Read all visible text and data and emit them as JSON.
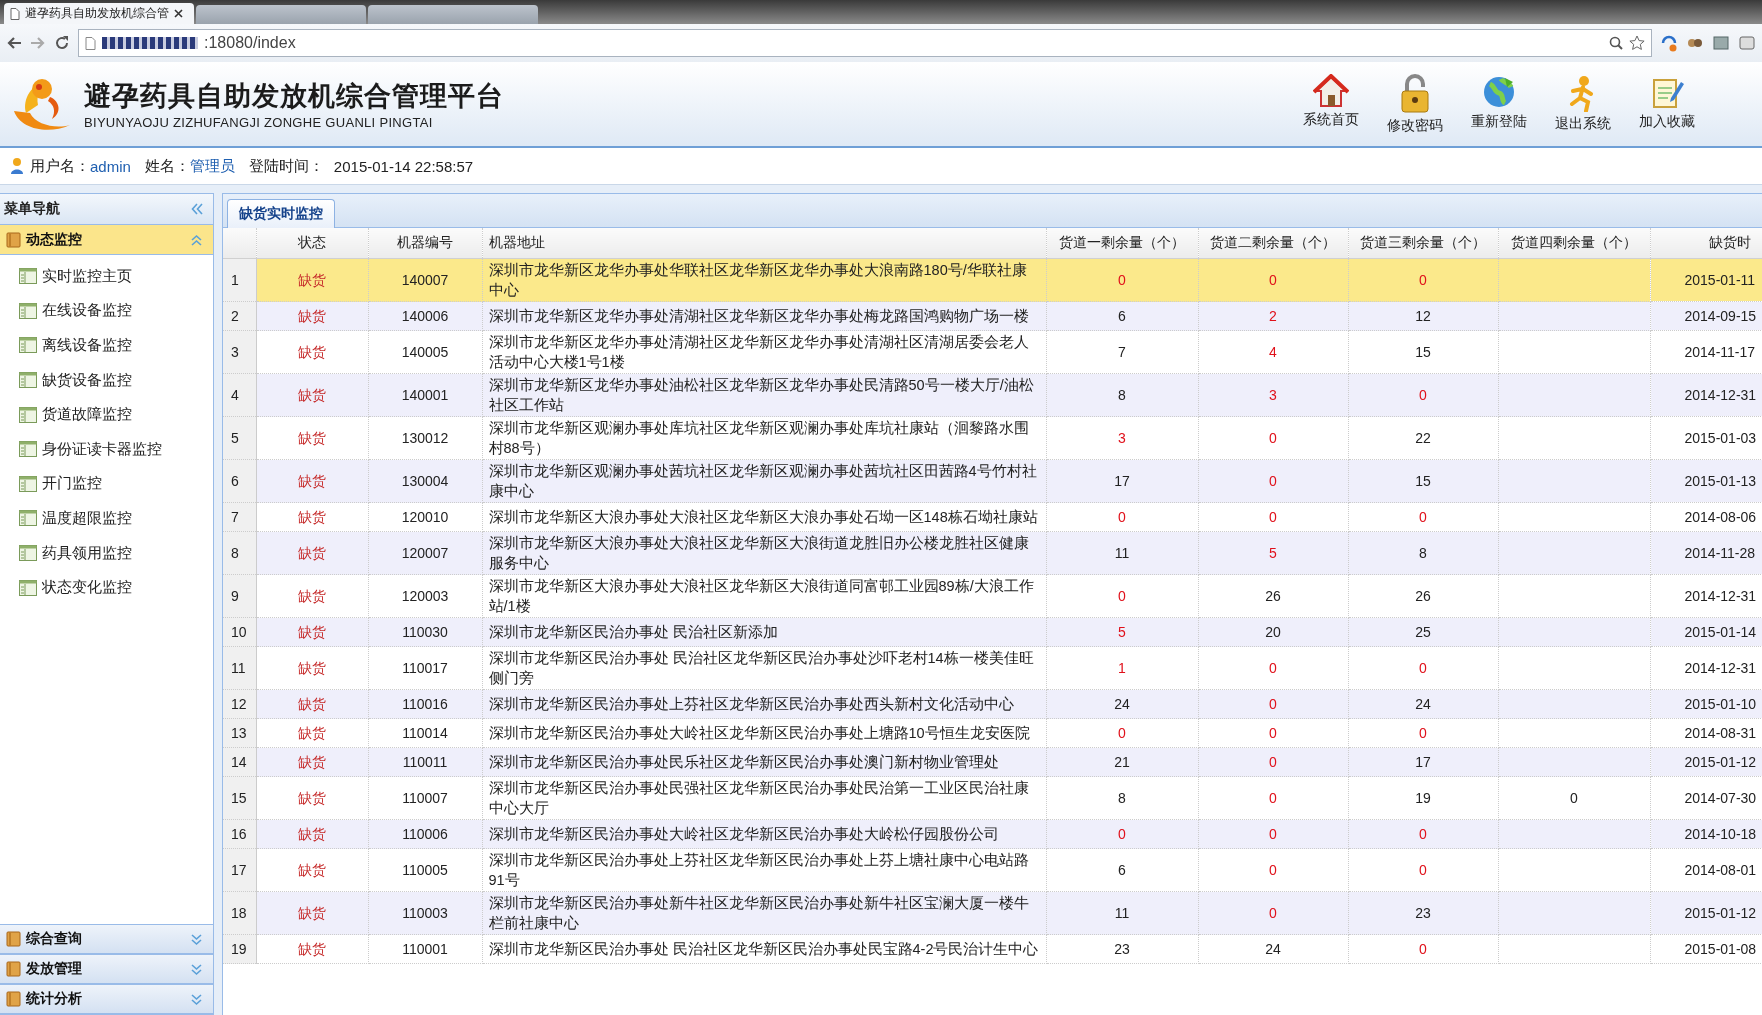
{
  "browser": {
    "tabs": [
      {
        "title": "避孕药具自助发放机综合管",
        "selected": true
      },
      {
        "selected": false
      },
      {
        "selected": false
      }
    ],
    "address": ":18080/index"
  },
  "header": {
    "title": "避孕药具自助发放机综合管理平台",
    "subtitle": "BIYUNYAOJU ZIZHUFANGJI ZONGHE GUANLI PINGTAI",
    "actions": [
      {
        "label": "系统首页",
        "kind": "home"
      },
      {
        "label": "修改密码",
        "kind": "lock"
      },
      {
        "label": "重新登陆",
        "kind": "globe"
      },
      {
        "label": "退出系统",
        "kind": "exit"
      },
      {
        "label": "加入收藏",
        "kind": "favorite"
      }
    ]
  },
  "user_bar": {
    "username_label": "用户名：",
    "username": "admin",
    "name_label": "姓名：",
    "name": "管理员",
    "login_label": "登陆时间：",
    "login_time": "2015-01-14 22:58:57"
  },
  "sidebar": {
    "title": "菜单导航",
    "groups": [
      {
        "label": "动态监控",
        "expanded": true,
        "items": [
          "实时监控主页",
          "在线设备监控",
          "离线设备监控",
          "缺货设备监控",
          "货道故障监控",
          "身份证读卡器监控",
          "开门监控",
          "温度超限监控",
          "药具领用监控",
          "状态变化监控"
        ]
      },
      {
        "label": "综合查询",
        "expanded": false
      },
      {
        "label": "发放管理",
        "expanded": false
      },
      {
        "label": "统计分析",
        "expanded": false
      }
    ]
  },
  "tabs": [
    {
      "label": "缺货实时监控",
      "selected": true
    }
  ],
  "table": {
    "columns": [
      "状态",
      "机器编号",
      "机器地址",
      "货道一剩余量（个）",
      "货道二剩余量（个）",
      "货道三剩余量（个）",
      "货道四剩余量（个）",
      "缺货时"
    ],
    "rows": [
      {
        "index": "1",
        "selected": true,
        "status": "缺货",
        "machine": "140007",
        "address": "深圳市龙华新区龙华办事处华联社区龙华新区龙华办事处大浪南路180号/华联社康中心",
        "lanes": [
          {
            "value": "0",
            "alert": true
          },
          {
            "value": "0",
            "alert": true
          },
          {
            "value": "0",
            "alert": true
          }
        ],
        "time": "2015-01-11"
      },
      {
        "index": "2",
        "selected": false,
        "status": "缺货",
        "machine": "140006",
        "address": "深圳市龙华新区龙华办事处清湖社区龙华新区龙华办事处梅龙路国鸿购物广场一楼",
        "lanes": [
          {
            "value": "6",
            "alert": false
          },
          {
            "value": "2",
            "alert": true
          },
          {
            "value": "12",
            "alert": false
          }
        ],
        "time": "2014-09-15"
      },
      {
        "index": "3",
        "selected": false,
        "status": "缺货",
        "machine": "140005",
        "address": "深圳市龙华新区龙华办事处清湖社区龙华新区龙华办事处清湖社区清湖居委会老人活动中心大楼1号1楼",
        "lanes": [
          {
            "value": "7",
            "alert": false
          },
          {
            "value": "4",
            "alert": true
          },
          {
            "value": "15",
            "alert": false
          }
        ],
        "time": "2014-11-17"
      },
      {
        "index": "4",
        "selected": false,
        "status": "缺货",
        "machine": "140001",
        "address": "深圳市龙华新区龙华办事处油松社区龙华新区龙华办事处民清路50号一楼大厅/油松社区工作站",
        "lanes": [
          {
            "value": "8",
            "alert": false
          },
          {
            "value": "3",
            "alert": true
          },
          {
            "value": "0",
            "alert": true
          }
        ],
        "time": "2014-12-31"
      },
      {
        "index": "5",
        "selected": false,
        "status": "缺货",
        "machine": "130012",
        "address": "深圳市龙华新区观澜办事处库坑社区龙华新区观澜办事处库坑社康站（洄黎路水围村88号）",
        "lanes": [
          {
            "value": "3",
            "alert": true
          },
          {
            "value": "0",
            "alert": true
          },
          {
            "value": "22",
            "alert": false
          }
        ],
        "time": "2015-01-03"
      },
      {
        "index": "6",
        "selected": false,
        "status": "缺货",
        "machine": "130004",
        "address": "深圳市龙华新区观澜办事处茜坑社区龙华新区观澜办事处茜坑社区田茜路4号竹村社康中心",
        "lanes": [
          {
            "value": "17",
            "alert": false
          },
          {
            "value": "0",
            "alert": true
          },
          {
            "value": "15",
            "alert": false
          }
        ],
        "time": "2015-01-13"
      },
      {
        "index": "7",
        "selected": false,
        "status": "缺货",
        "machine": "120010",
        "address": "深圳市龙华新区大浪办事处大浪社区龙华新区大浪办事处石坳一区148栋石坳社康站",
        "lanes": [
          {
            "value": "0",
            "alert": true
          },
          {
            "value": "0",
            "alert": true
          },
          {
            "value": "0",
            "alert": true
          }
        ],
        "time": "2014-08-06"
      },
      {
        "index": "8",
        "selected": false,
        "status": "缺货",
        "machine": "120007",
        "address": "深圳市龙华新区大浪办事处大浪社区龙华新区大浪街道龙胜旧办公楼龙胜社区健康服务中心",
        "lanes": [
          {
            "value": "11",
            "alert": false
          },
          {
            "value": "5",
            "alert": true
          },
          {
            "value": "8",
            "alert": false
          }
        ],
        "time": "2014-11-28"
      },
      {
        "index": "9",
        "selected": false,
        "status": "缺货",
        "machine": "120003",
        "address": "深圳市龙华新区大浪办事处大浪社区龙华新区大浪街道同富邨工业园89栋/大浪工作站/1楼",
        "lanes": [
          {
            "value": "0",
            "alert": true
          },
          {
            "value": "26",
            "alert": false
          },
          {
            "value": "26",
            "alert": false
          }
        ],
        "time": "2014-12-31"
      },
      {
        "index": "10",
        "selected": false,
        "status": "缺货",
        "machine": "110030",
        "address": "深圳市龙华新区民治办事处 民治社区新添加",
        "lanes": [
          {
            "value": "5",
            "alert": true
          },
          {
            "value": "20",
            "alert": false
          },
          {
            "value": "25",
            "alert": false
          }
        ],
        "time": "2015-01-14"
      },
      {
        "index": "11",
        "selected": false,
        "status": "缺货",
        "machine": "110017",
        "address": "深圳市龙华新区民治办事处 民治社区龙华新区民治办事处沙吓老村14栋一楼美佳旺侧门旁",
        "lanes": [
          {
            "value": "1",
            "alert": true
          },
          {
            "value": "0",
            "alert": true
          },
          {
            "value": "0",
            "alert": true
          }
        ],
        "time": "2014-12-31"
      },
      {
        "index": "12",
        "selected": false,
        "status": "缺货",
        "machine": "110016",
        "address": "深圳市龙华新区民治办事处上芬社区龙华新区民治办事处西头新村文化活动中心",
        "lanes": [
          {
            "value": "24",
            "alert": false
          },
          {
            "value": "0",
            "alert": true
          },
          {
            "value": "24",
            "alert": false
          }
        ],
        "time": "2015-01-10"
      },
      {
        "index": "13",
        "selected": false,
        "status": "缺货",
        "machine": "110014",
        "address": "深圳市龙华新区民治办事处大岭社区龙华新区民治办事处上塘路10号恒生龙安医院",
        "lanes": [
          {
            "value": "0",
            "alert": true
          },
          {
            "value": "0",
            "alert": true
          },
          {
            "value": "0",
            "alert": true
          }
        ],
        "time": "2014-08-31"
      },
      {
        "index": "14",
        "selected": false,
        "status": "缺货",
        "machine": "110011",
        "address": "深圳市龙华新区民治办事处民乐社区龙华新区民治办事处澳门新村物业管理处",
        "lanes": [
          {
            "value": "21",
            "alert": false
          },
          {
            "value": "0",
            "alert": true
          },
          {
            "value": "17",
            "alert": false
          }
        ],
        "time": "2015-01-12"
      },
      {
        "index": "15",
        "selected": false,
        "status": "缺货",
        "machine": "110007",
        "address": "深圳市龙华新区民治办事处民强社区龙华新区民治办事处民治第一工业区民治社康中心大厅",
        "lanes": [
          {
            "value": "8",
            "alert": false
          },
          {
            "value": "0",
            "alert": true
          },
          {
            "value": "19",
            "alert": false
          },
          {
            "value": "0",
            "alert": false
          }
        ],
        "time": "2014-07-30"
      },
      {
        "index": "16",
        "selected": false,
        "status": "缺货",
        "machine": "110006",
        "address": "深圳市龙华新区民治办事处大岭社区龙华新区民治办事处大岭松仔园股份公司",
        "lanes": [
          {
            "value": "0",
            "alert": true
          },
          {
            "value": "0",
            "alert": true
          },
          {
            "value": "0",
            "alert": true
          }
        ],
        "time": "2014-10-18"
      },
      {
        "index": "17",
        "selected": false,
        "status": "缺货",
        "machine": "110005",
        "address": "深圳市龙华新区民治办事处上芬社区龙华新区民治办事处上芬上塘社康中心电站路91号",
        "lanes": [
          {
            "value": "6",
            "alert": false
          },
          {
            "value": "0",
            "alert": true
          },
          {
            "value": "0",
            "alert": true
          }
        ],
        "time": "2014-08-01"
      },
      {
        "index": "18",
        "selected": false,
        "status": "缺货",
        "machine": "110003",
        "address": "深圳市龙华新区民治办事处新牛社区龙华新区民治办事处新牛社区宝澜大厦一楼牛栏前社康中心",
        "lanes": [
          {
            "value": "11",
            "alert": false
          },
          {
            "value": "0",
            "alert": true
          },
          {
            "value": "23",
            "alert": false
          }
        ],
        "time": "2015-01-12"
      },
      {
        "index": "19",
        "selected": false,
        "status": "缺货",
        "machine": "110001",
        "address": "深圳市龙华新区民治办事处 民治社区龙华新区民治办事处民宝路4-2号民治计生中心",
        "lanes": [
          {
            "value": "23",
            "alert": false
          },
          {
            "value": "24",
            "alert": false
          },
          {
            "value": "0",
            "alert": true
          }
        ],
        "time": "2015-01-08"
      }
    ]
  }
}
